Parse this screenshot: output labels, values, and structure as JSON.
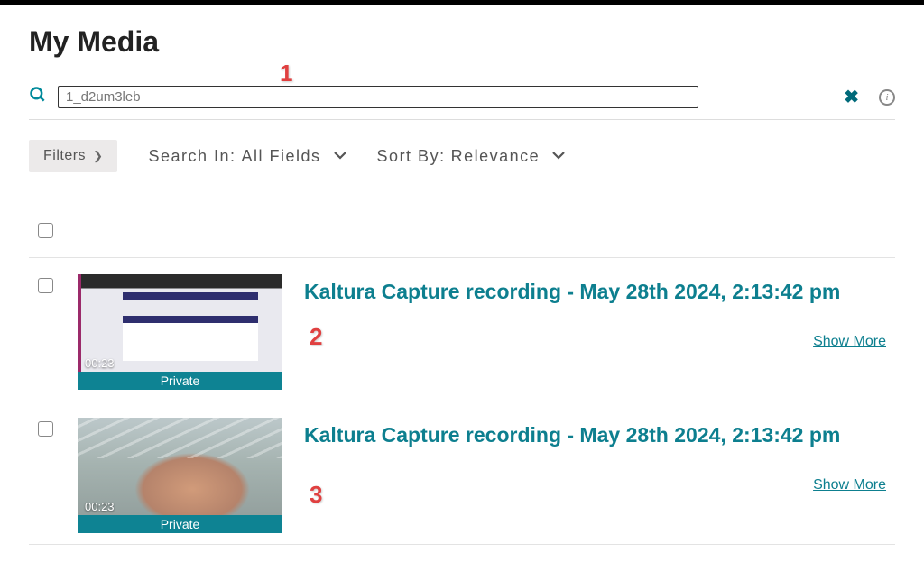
{
  "title": "My Media",
  "search": {
    "value": "1_d2um3leb"
  },
  "annotations": {
    "a1": "1",
    "a2": "2",
    "a3": "3"
  },
  "filters": {
    "button": "Filters",
    "search_in_prefix": "Search In:",
    "search_in_value": "All Fields",
    "sort_by_prefix": "Sort By:",
    "sort_by_value": "Relevance"
  },
  "media": [
    {
      "title": "Kaltura Capture recording - May 28th 2024, 2:13:42 pm",
      "duration": "00:23",
      "privacy": "Private",
      "show_more": "Show More"
    },
    {
      "title": "Kaltura Capture recording - May 28th 2024, 2:13:42 pm",
      "duration": "00:23",
      "privacy": "Private",
      "show_more": "Show More"
    }
  ]
}
